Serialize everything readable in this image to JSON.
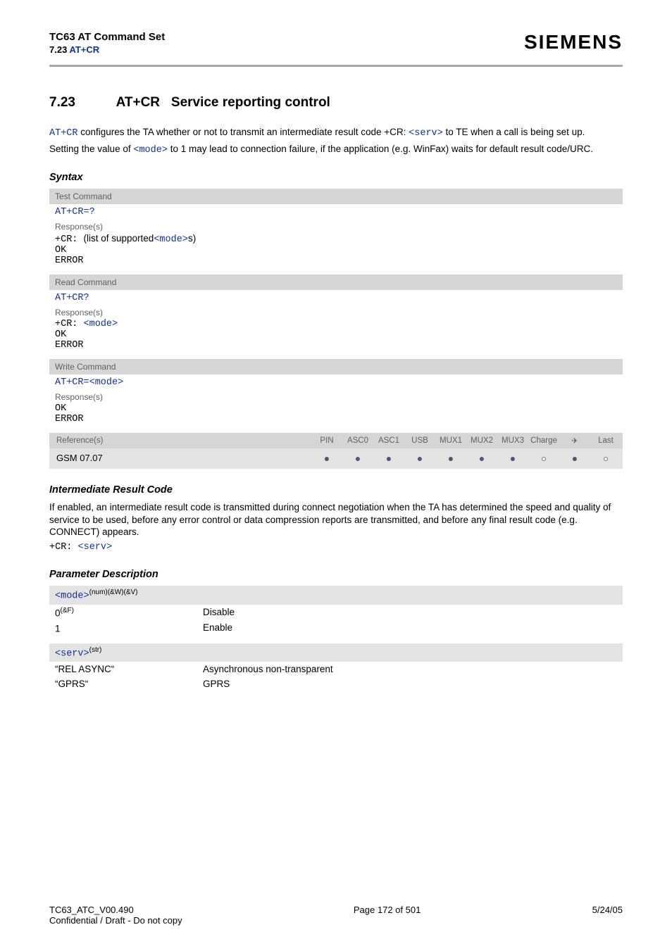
{
  "header": {
    "title_line1": "TC63 AT Command Set",
    "title_line2_prefix": "7.23 ",
    "title_line2_cmd": "AT+CR",
    "brand": "SIEMENS"
  },
  "section": {
    "number": "7.23",
    "cmd": "AT+CR",
    "title_rest": "Service reporting control"
  },
  "intro": {
    "l1_a": "AT+CR",
    "l1_b": " configures the TA whether or not to transmit an intermediate result code +CR: ",
    "l1_c": "<serv>",
    "l1_d": " to TE when a call is being set up.",
    "l2_a": "Setting the value of ",
    "l2_b": "<mode>",
    "l2_c": " to 1 may lead to connection failure, if the application (e.g. WinFax) waits for default result code/URC."
  },
  "syntax": {
    "heading": "Syntax",
    "test": {
      "bar": "Test Command",
      "cmd": "AT+CR=?",
      "resp_label": "Response(s)",
      "line1_a": "+CR: ",
      "line1_b": "(list of supported",
      "line1_c": "<mode>",
      "line1_d": "s)",
      "ok": "OK",
      "err": "ERROR"
    },
    "read": {
      "bar": "Read Command",
      "cmd": "AT+CR?",
      "resp_label": "Response(s)",
      "line1_a": "+CR: ",
      "line1_b": "<mode>",
      "ok": "OK",
      "err": "ERROR"
    },
    "write": {
      "bar": "Write Command",
      "cmd_a": "AT+CR=",
      "cmd_b": "<mode>",
      "resp_label": "Response(s)",
      "ok": "OK",
      "err": "ERROR"
    },
    "ref": {
      "label": "Reference(s)",
      "cols": [
        "PIN",
        "ASC0",
        "ASC1",
        "USB",
        "MUX1",
        "MUX2",
        "MUX3",
        "Charge",
        "✈",
        "Last"
      ],
      "row_label": "GSM 07.07",
      "row_dots": [
        "solid",
        "solid",
        "solid",
        "solid",
        "solid",
        "solid",
        "solid",
        "open",
        "solid",
        "open"
      ]
    }
  },
  "irc": {
    "heading": "Intermediate Result Code",
    "para": "If enabled, an intermediate result code is transmitted during connect negotiation when the TA has determined the speed and quality of service to be used, before any error control or data compression reports are transmitted, and before any final result code (e.g. CONNECT) appears.",
    "code_a": "+CR: ",
    "code_b": "<serv>"
  },
  "params": {
    "heading": "Parameter Description",
    "mode": {
      "head_a": "<mode>",
      "head_sup": "(num)(&W)(&V)",
      "rows": [
        {
          "k": "0",
          "ksup": "(&F)",
          "v": "Disable"
        },
        {
          "k": "1",
          "ksup": "",
          "v": "Enable"
        }
      ]
    },
    "serv": {
      "head_a": "<serv>",
      "head_sup": "(str)",
      "rows": [
        {
          "k": "“REL ASYNC“",
          "v": "Asynchronous non-transparent"
        },
        {
          "k": "“GPRS“",
          "v": "GPRS"
        }
      ]
    }
  },
  "footer": {
    "left_a": "TC63_ATC_V00.490",
    "left_b": "Confidential / Draft - Do not copy",
    "mid": "Page 172 of 501",
    "right": "5/24/05"
  }
}
